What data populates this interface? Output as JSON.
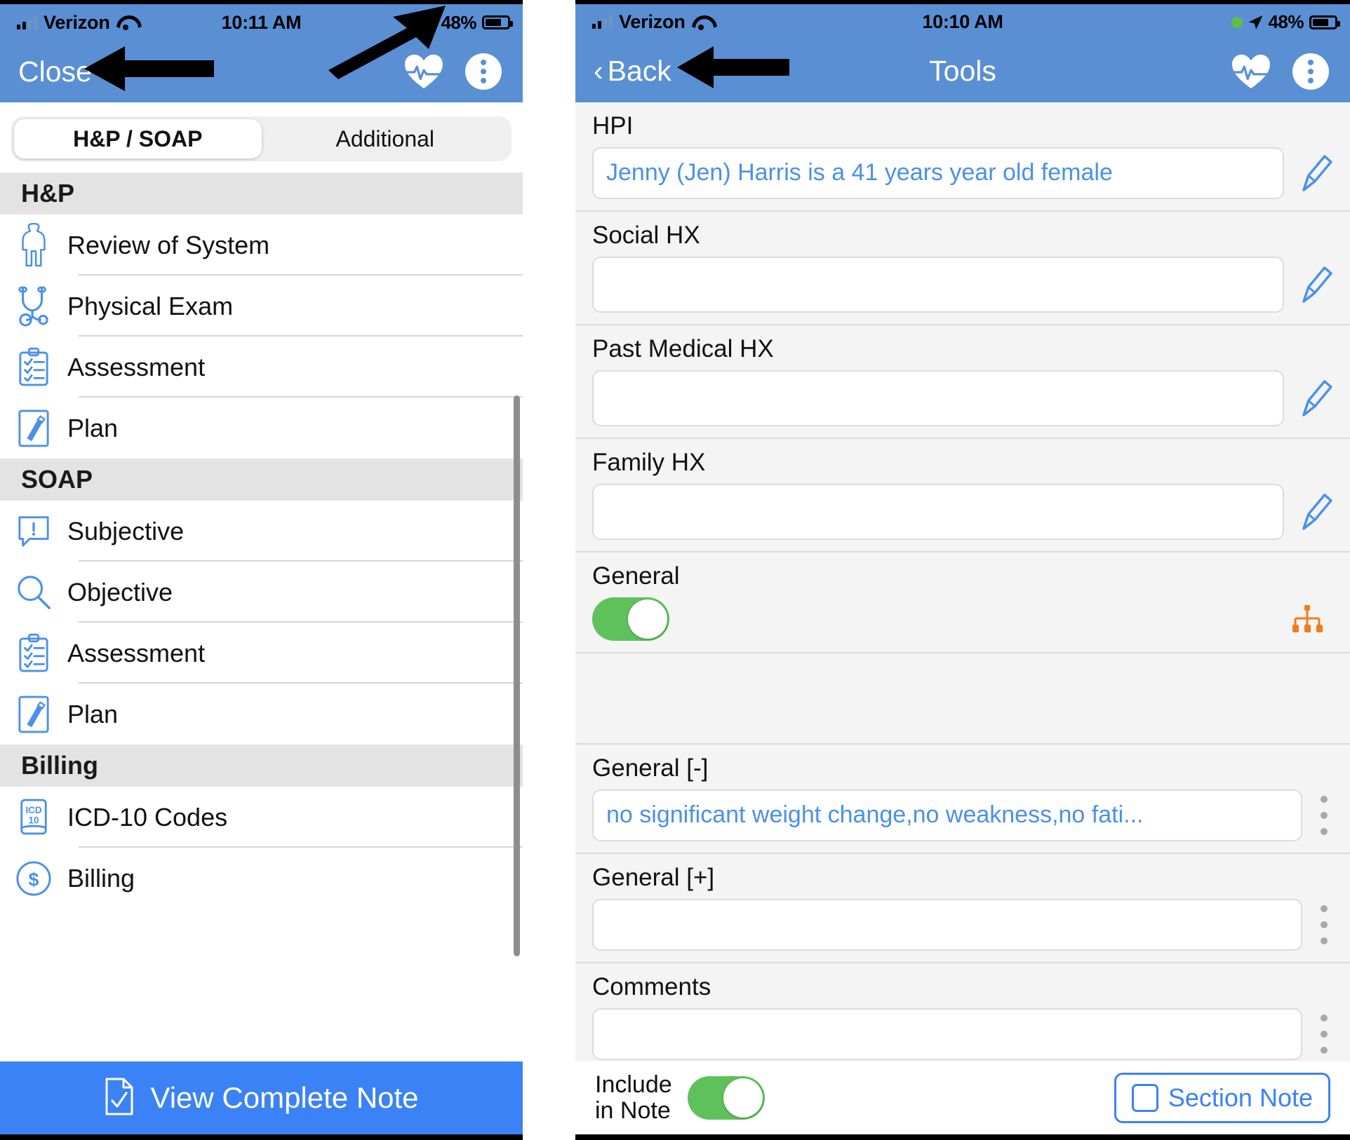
{
  "left_phone": {
    "status_bar": {
      "carrier": "Verizon",
      "time": "10:11 AM",
      "battery_pct": "48%",
      "signal_icon": "cellular-bars-icon",
      "wifi_icon": "wifi-icon",
      "recording_icon": "green-dot-icon",
      "location_icon": "location-arrow-icon",
      "battery_icon": "battery-icon"
    },
    "nav": {
      "close_label": "Close",
      "heart_icon": "heart-pulse-icon",
      "more_icon": "more-vertical-icon"
    },
    "tabs": [
      {
        "label": "H&P / SOAP",
        "active": true
      },
      {
        "label": "Additional",
        "active": false
      }
    ],
    "groups": [
      {
        "title": "H&P",
        "rows": [
          {
            "label": "Review of System",
            "icon": "person-body-icon"
          },
          {
            "label": "Physical Exam",
            "icon": "stethoscope-icon"
          },
          {
            "label": "Assessment",
            "icon": "clipboard-checklist-icon"
          },
          {
            "label": "Plan",
            "icon": "pen-document-icon"
          }
        ]
      },
      {
        "title": "SOAP",
        "rows": [
          {
            "label": "Subjective",
            "icon": "speech-bubble-exclamation-icon"
          },
          {
            "label": "Objective",
            "icon": "magnifier-icon"
          },
          {
            "label": "Assessment",
            "icon": "clipboard-checklist-icon"
          },
          {
            "label": "Plan",
            "icon": "pen-document-icon"
          }
        ]
      },
      {
        "title": "Billing",
        "rows": [
          {
            "label": "ICD-10 Codes",
            "icon": "icd10-book-icon"
          },
          {
            "label": "Billing",
            "icon": "dollar-circle-icon"
          }
        ]
      }
    ],
    "bottom_button": {
      "label": "View Complete Note",
      "icon": "document-check-icon"
    }
  },
  "right_phone": {
    "status_bar": {
      "carrier": "Verizon",
      "time": "10:10 AM",
      "battery_pct": "48%",
      "signal_icon": "cellular-bars-icon",
      "wifi_icon": "wifi-icon",
      "recording_icon": "green-dot-icon",
      "location_icon": "location-arrow-icon",
      "battery_icon": "battery-icon"
    },
    "nav": {
      "back_label": "Back",
      "back_icon": "chevron-left-icon",
      "title": "Tools",
      "heart_icon": "heart-pulse-icon",
      "more_icon": "more-vertical-icon"
    },
    "fields": [
      {
        "label": "HPI",
        "value": "Jenny (Jen) Harris is a  41 years year old  female",
        "edit_icon": "pencil-icon"
      },
      {
        "label": "Social HX",
        "value": "",
        "edit_icon": "pencil-icon"
      },
      {
        "label": "Past Medical HX",
        "value": "",
        "edit_icon": "pencil-icon"
      },
      {
        "label": "Family HX",
        "value": "",
        "edit_icon": "pencil-icon"
      }
    ],
    "general_section": {
      "label": "General",
      "toggle_on": true,
      "tree_icon": "sitemap-hierarchy-icon",
      "tree_icon_color": "#f07c1e"
    },
    "sub_fields": [
      {
        "label": "General [-]",
        "value": "no significant weight change,no weakness,no fati...",
        "menu_icon": "more-vertical-icon"
      },
      {
        "label": "General [+]",
        "value": "",
        "menu_icon": "more-vertical-icon"
      },
      {
        "label": "Comments",
        "value": "",
        "menu_icon": "more-vertical-icon"
      }
    ],
    "bottom_bar": {
      "include_line1": "Include",
      "include_line2": "in Note",
      "include_toggle_on": true,
      "section_note_label": "Section Note",
      "section_note_checkbox_icon": "checkbox-empty-icon"
    }
  },
  "annotations": [
    {
      "name": "arrow-pointing-to-close",
      "icon": "left-arrow-annotation"
    },
    {
      "name": "arrow-pointing-to-heart-tool",
      "icon": "diagonal-arrow-annotation"
    },
    {
      "name": "arrow-pointing-to-back",
      "icon": "left-arrow-annotation"
    }
  ],
  "colors": {
    "nav_blue": "#5a8fd4",
    "accent_blue": "#3b82f6",
    "toggle_green": "#5ec15c",
    "group_header_gray": "#e3e3e3",
    "form_bg": "#f4f4f4",
    "orange": "#f07c1e"
  }
}
